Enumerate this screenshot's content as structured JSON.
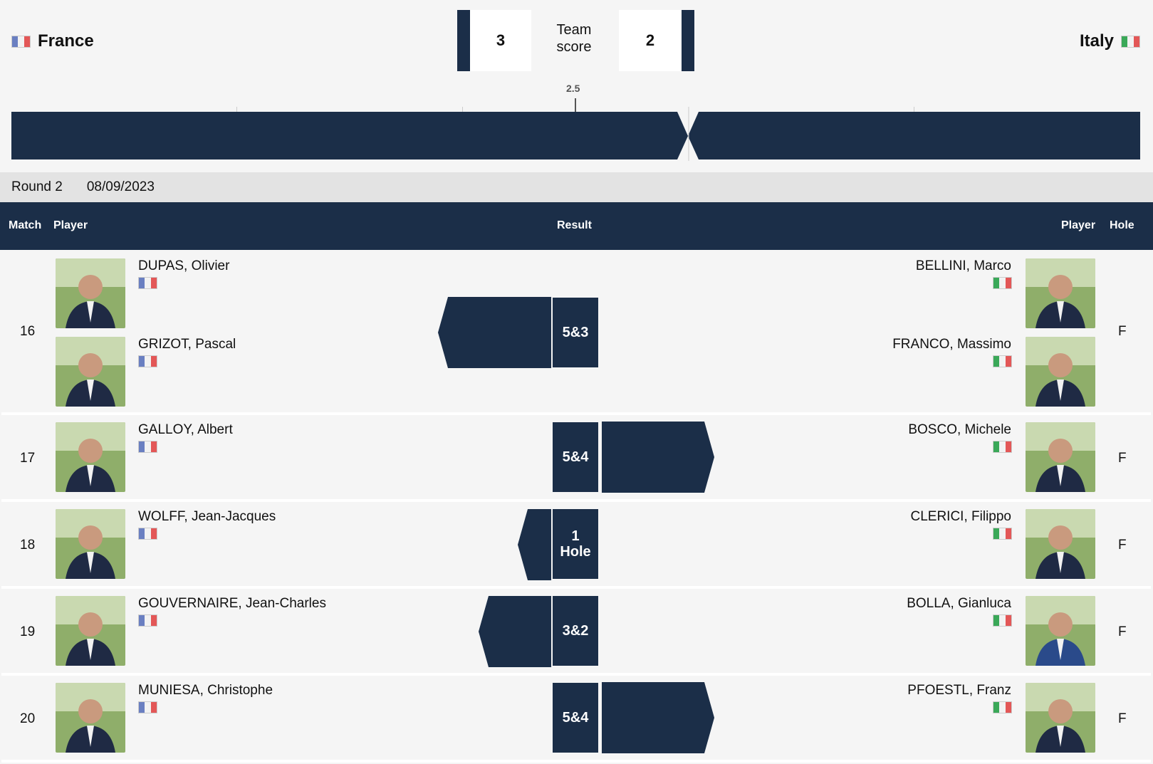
{
  "header": {
    "left_team": "France",
    "right_team": "Italy",
    "left_score": "3",
    "right_score": "2",
    "score_label_1": "Team",
    "score_label_2": "score",
    "midpoint_label": "2.5"
  },
  "round": {
    "label": "Round 2",
    "date": "08/09/2023"
  },
  "table_header": {
    "match": "Match",
    "player_left": "Player",
    "result": "Result",
    "player_right": "Player",
    "hole": "Hole"
  },
  "matches": [
    {
      "number": "16",
      "left_players": [
        "DUPAS, Olivier",
        "GRIZOT, Pascal"
      ],
      "right_players": [
        "BELLINI, Marco",
        "FRANCO, Massimo"
      ],
      "result": "5&3",
      "winner": "left",
      "hole": "F"
    },
    {
      "number": "17",
      "left_players": [
        "GALLOY, Albert"
      ],
      "right_players": [
        "BOSCO, Michele"
      ],
      "result": "5&4",
      "winner": "right",
      "hole": "F"
    },
    {
      "number": "18",
      "left_players": [
        "WOLFF, Jean-Jacques"
      ],
      "right_players": [
        "CLERICI, Filippo"
      ],
      "result_line1": "1",
      "result_line2": "Hole",
      "winner": "left",
      "hole": "F"
    },
    {
      "number": "19",
      "left_players": [
        "GOUVERNAIRE, Jean-Charles"
      ],
      "right_players": [
        "BOLLA, Gianluca"
      ],
      "result": "3&2",
      "winner": "left",
      "hole": "F"
    },
    {
      "number": "20",
      "left_players": [
        "MUNIESA, Christophe"
      ],
      "right_players": [
        "PFOESTL, Franz"
      ],
      "result": "5&4",
      "winner": "right",
      "hole": "F"
    }
  ],
  "colors": {
    "navy": "#1b2e48",
    "background": "#f5f5f5",
    "round_bar": "#e3e3e3"
  },
  "icons": {
    "france_flag": "france-flag-icon",
    "italy_flag": "italy-flag-icon"
  }
}
